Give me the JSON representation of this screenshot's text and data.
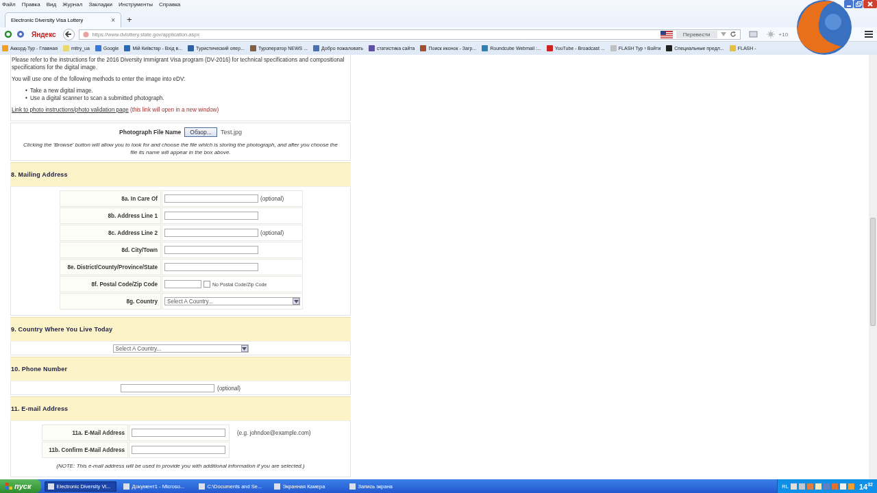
{
  "menu": [
    "Файл",
    "Правка",
    "Вид",
    "Журнал",
    "Закладки",
    "Инструменты",
    "Справка"
  ],
  "tab": {
    "title": "Electronic Diversity Visa Lottery",
    "close": "×",
    "new_tab": "+"
  },
  "nav": {
    "brand": "Яндекс",
    "url": "https://www.dvlottery.state.gov/application.aspx",
    "translate": "Перевести",
    "weather": "+10"
  },
  "bookmarks": [
    {
      "label": "Аккорд-Тур - Главная",
      "color": "#f0a020"
    },
    {
      "label": "mitry_ua",
      "color": "#e8d870"
    },
    {
      "label": "Google",
      "color": "#3a78d8"
    },
    {
      "label": "Мій Київстар - Вхід в...",
      "color": "#2a6ab8"
    },
    {
      "label": "Туристический опер...",
      "color": "#3060a0"
    },
    {
      "label": "Туроператор NEWS ...",
      "color": "#806040"
    },
    {
      "label": "Добро пожаловать",
      "color": "#4a70b0"
    },
    {
      "label": "статистика сайта",
      "color": "#6050a0"
    },
    {
      "label": "Поиск иконок - Загр...",
      "color": "#a05030"
    },
    {
      "label": "Roundcube Webmail :...",
      "color": "#3080b0"
    },
    {
      "label": "YouTube - Broadcast ...",
      "color": "#d02020"
    },
    {
      "label": "FLASH Тур › Войти",
      "color": "#c0c0c0"
    },
    {
      "label": "Специальные предл...",
      "color": "#202020"
    },
    {
      "label": "FLASH -",
      "color": "#e8c040"
    }
  ],
  "form": {
    "intro": "Please refer to the instructions for the 2016 Diversity Immigrant Visa program (DV-2016) for technical specifications and compositional specifications for the digital image.",
    "methods_intro": "You will use one of the following methods to enter the image into eDV:",
    "bullet": "•",
    "methods": [
      "Take a new digital image.",
      "Use a digital scanner to scan a submitted photograph."
    ],
    "photo_link": "Link to photo instructions/photo validation page",
    "photo_link_note": "(this link will open in a new window)",
    "photo": {
      "label": "Photograph File Name",
      "button": "Обзор...",
      "file": "Test.jpg",
      "help": "Clicking the 'Browse' button will allow you to look for and choose the file which is storing the photograph, and after you choose the file its name will appear in the box above."
    },
    "sections": [
      {
        "title": "8. Mailing Address",
        "kind": "table",
        "rows": [
          {
            "label": "8a. In Care Of",
            "kind": "text",
            "note": "(optional)"
          },
          {
            "label": "8b. Address Line 1",
            "kind": "text"
          },
          {
            "label": "8c. Address Line 2",
            "kind": "text",
            "note": "(optional)"
          },
          {
            "label": "8d. City/Town",
            "kind": "text"
          },
          {
            "label": "8e. District/County/Province/State",
            "kind": "text"
          },
          {
            "label": "8f. Postal Code/Zip Code",
            "kind": "zip",
            "checkbox_label": "No Postal Code/Zip Code",
            "checked": false
          },
          {
            "label": "8g. Country",
            "kind": "select",
            "value": "Select A Country..."
          }
        ]
      },
      {
        "title": "9. Country Where You Live Today",
        "kind": "single",
        "rows": [
          {
            "kind": "select",
            "value": "Select A Country..."
          }
        ]
      },
      {
        "title": "10. Phone Number",
        "kind": "single",
        "rows": [
          {
            "kind": "text",
            "note": "(optional)"
          }
        ]
      },
      {
        "title": "11. E-mail Address",
        "kind": "email",
        "rows": [
          {
            "label": "11a. E-Mail Address",
            "kind": "text",
            "note": "(e.g. johndoe@example.com)"
          },
          {
            "label": "11b. Confirm E-Mail Address",
            "kind": "text"
          }
        ],
        "note": "(NOTE: This e-mail address will be used to provide you with additional information if you are selected.)"
      }
    ]
  },
  "taskbar": {
    "start": "пуск",
    "tasks": [
      {
        "label": "Electronic Diversity Vi...",
        "selected": true
      },
      {
        "label": "Документ1 - Microso...",
        "selected": false
      },
      {
        "label": "C:\\Documents and Se...",
        "selected": false
      },
      {
        "label": "Экранная Камера",
        "selected": false
      },
      {
        "label": "Запись экрана",
        "selected": false
      }
    ],
    "lang": "RL",
    "hours": "14",
    "minutes": "32"
  }
}
